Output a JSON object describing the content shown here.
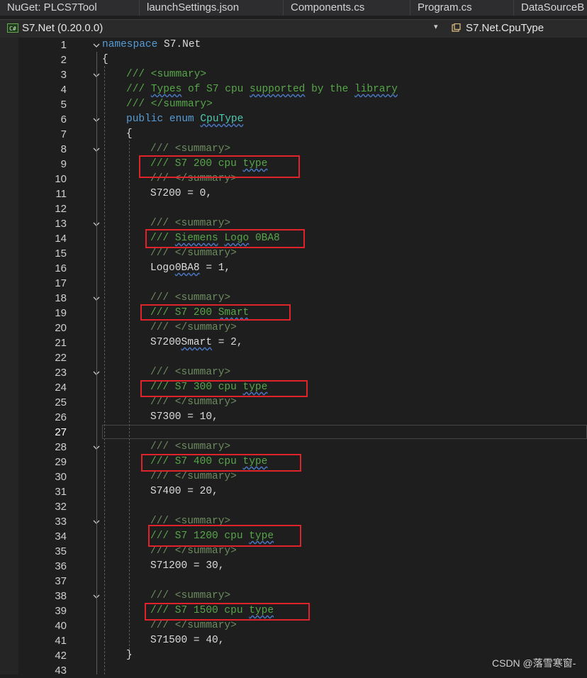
{
  "tabs": [
    "NuGet: PLCS7Tool",
    "launchSettings.json",
    "Components.cs",
    "Program.cs",
    "DataSourceB"
  ],
  "nav": {
    "badge": "C#",
    "project": "S7.Net (0.20.0.0)",
    "dropdown_glyph": "▾",
    "member": "S7.Net.CpuType"
  },
  "line_numbers": [
    "1",
    "2",
    "3",
    "4",
    "5",
    "6",
    "7",
    "8",
    "9",
    "10",
    "11",
    "12",
    "13",
    "14",
    "15",
    "16",
    "17",
    "18",
    "19",
    "20",
    "21",
    "22",
    "23",
    "24",
    "25",
    "26",
    "27",
    "28",
    "29",
    "30",
    "31",
    "32",
    "33",
    "34",
    "35",
    "36",
    "37",
    "38",
    "39",
    "40",
    "41",
    "42",
    "43"
  ],
  "code": {
    "l1_kw": "namespace",
    "l1_name": " S7.Net",
    "l2": "{",
    "l3": "/// <summary>",
    "l4_a": "/// ",
    "l4_w1": "Types",
    "l4_b": " of S7 cpu ",
    "l4_w2": "supported",
    "l4_c": " by the ",
    "l4_w3": "library",
    "l5": "/// </summary>",
    "l6_kw": "public enum ",
    "l6_name": "CpuType",
    "l7": "{",
    "l8": "/// <summary>",
    "l9_a": "/// S7 200 cpu ",
    "l9_w": "type",
    "l10": "/// </summary>",
    "l11": "S7200 = 0,",
    "l13": "/// <summary>",
    "l14_a": "/// ",
    "l14_w1": "Siemens",
    "l14_b": " ",
    "l14_w2": "Logo",
    "l14_c": " 0BA8",
    "l15": "/// </summary>",
    "l16_a": "Logo",
    "l16_w": "0BA8",
    "l16_b": " = 1,",
    "l18": "/// <summary>",
    "l19_a": "/// S7 200 ",
    "l19_w": "Smart",
    "l20": "/// </summary>",
    "l21_a": "S7200",
    "l21_w": "Smart",
    "l21_b": " = 2,",
    "l23": "/// <summary>",
    "l24_a": "/// S7 300 cpu ",
    "l24_w": "type",
    "l25": "/// </summary>",
    "l26": "S7300 = 10,",
    "l28": "/// <summary>",
    "l29_a": "/// S7 400 cpu ",
    "l29_w": "type",
    "l30": "/// </summary>",
    "l31": "S7400 = 20,",
    "l33": "/// <summary>",
    "l34_a": "/// S7 1200 cpu ",
    "l34_w": "type",
    "l35": "/// </summary>",
    "l36": "S71200 = 30,",
    "l38": "/// <summary>",
    "l39_a": "/// S7 1500 cpu ",
    "l39_w": "type",
    "l40": "/// </summary>",
    "l41": "S71500 = 40,",
    "l42": "}"
  },
  "watermark": "CSDN @落雪寒窗-",
  "colors": {
    "background": "#1e1e1e",
    "comment": "#57a64a",
    "keyword": "#569cd6",
    "highlight_box": "#e0232b"
  }
}
